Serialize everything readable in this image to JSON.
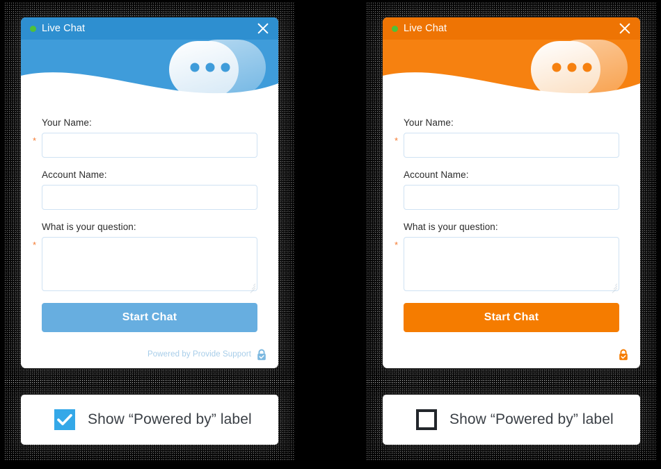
{
  "theme": {
    "blue_header": "#2e8fd0",
    "blue_header_light": "#3f9cda",
    "blue_button": "#67aee0",
    "blue_checkbox": "#34a8e8",
    "orange_header": "#ee7404",
    "orange_header_light": "#f68110",
    "orange_button": "#f57c00",
    "status_dot": "#4ec13a",
    "required_star": "#f47b32",
    "input_border": "#cfe2f3",
    "powered_text": "#a7cde9",
    "background": "#000000"
  },
  "panels": [
    {
      "id": "blue-panel",
      "accent": "blue",
      "titlebar": {
        "status_dot": "online-dot",
        "title": "Live Chat",
        "close_icon": "close-icon"
      },
      "header_art": {
        "bubbles_icon": "chat-bubbles-icon",
        "wave": "wave-divider"
      },
      "form": {
        "fields": [
          {
            "label": "Your Name:",
            "required": true,
            "required_mark": "*",
            "value": "",
            "placeholder": "",
            "type": "text"
          },
          {
            "label": "Account Name:",
            "required": false,
            "required_mark": "",
            "value": "",
            "placeholder": "",
            "type": "text"
          },
          {
            "label": "What is your question:",
            "required": true,
            "required_mark": "*",
            "value": "",
            "placeholder": "",
            "type": "textarea"
          }
        ],
        "submit_label": "Start Chat"
      },
      "footer": {
        "show_text": true,
        "text": "Powered by Provide Support",
        "lock_icon": "lock-check-icon",
        "lock_color": "#7cb8e0"
      }
    },
    {
      "id": "orange-panel",
      "accent": "orange",
      "titlebar": {
        "status_dot": "online-dot",
        "title": "Live Chat",
        "close_icon": "close-icon"
      },
      "header_art": {
        "bubbles_icon": "chat-bubbles-icon",
        "wave": "wave-divider"
      },
      "form": {
        "fields": [
          {
            "label": "Your Name:",
            "required": true,
            "required_mark": "*",
            "value": "",
            "placeholder": "",
            "type": "text"
          },
          {
            "label": "Account Name:",
            "required": false,
            "required_mark": "",
            "value": "",
            "placeholder": "",
            "type": "text"
          },
          {
            "label": "What is your question:",
            "required": true,
            "required_mark": "*",
            "value": "",
            "placeholder": "",
            "type": "textarea"
          }
        ],
        "submit_label": "Start Chat"
      },
      "footer": {
        "show_text": false,
        "text": "",
        "lock_icon": "lock-check-icon",
        "lock_color": "#f57c00"
      }
    }
  ],
  "checkbox_cards": [
    {
      "id": "checkbox-card-left",
      "checked": true,
      "check_icon": "check-icon",
      "label": "Show “Powered by” label"
    },
    {
      "id": "checkbox-card-right",
      "checked": false,
      "check_icon": "",
      "label": "Show “Powered by” label"
    }
  ]
}
